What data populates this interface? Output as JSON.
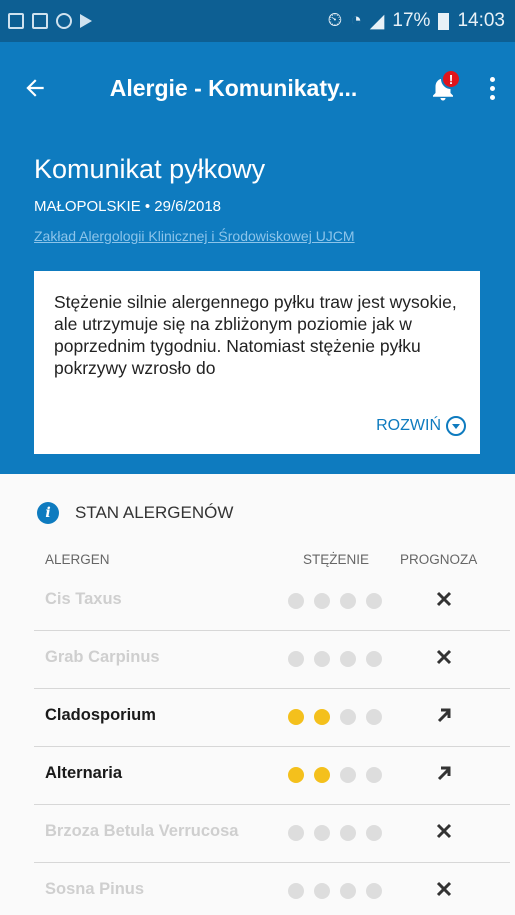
{
  "status_bar": {
    "icons": [
      "gallery-icon",
      "clipboard-icon",
      "bug-icon",
      "play-store-icon"
    ],
    "right_text": "⏲ ◴ ◢ 17% ",
    "battery_percent": "17%",
    "time": "14:03"
  },
  "appbar": {
    "title": "Alergie - Komunikaty...",
    "notification_badge": "!"
  },
  "header": {
    "title": "Komunikat pyłkowy",
    "meta": "MAŁOPOLSKIE • 29/6/2018",
    "link": "Zakład Alergologii Klinicznej i Środowiskowej UJCM",
    "card_text": "Stężenie silnie alergennego pyłku traw jest wysokie, ale utrzymuje się na zbliżonym poziomie jak w poprzednim tygodniu. Natomiast stężenie pyłku pokrzywy wzrosło do",
    "expand_label": "ROZWIŃ"
  },
  "allergens": {
    "section_title": "STAN ALERGENÓW",
    "col_allergen": "ALERGEN",
    "col_concentration": "STĘŻENIE",
    "col_forecast": "PROGNOZA",
    "rows": [
      {
        "name": "Cis Taxus",
        "active": false,
        "level": 0,
        "forecast": "none"
      },
      {
        "name": "Grab Carpinus",
        "active": false,
        "level": 0,
        "forecast": "none"
      },
      {
        "name": "Cladosporium",
        "active": true,
        "level": 2,
        "forecast": "rising"
      },
      {
        "name": "Alternaria",
        "active": true,
        "level": 2,
        "forecast": "rising"
      },
      {
        "name": "Brzoza Betula Verrucosa",
        "active": false,
        "level": 0,
        "forecast": "none"
      },
      {
        "name": "Sosna Pinus",
        "active": false,
        "level": 0,
        "forecast": "none"
      }
    ],
    "max_level": 4
  },
  "colors": {
    "primary": "#0e7bbf",
    "statusbar": "#0d5f93",
    "badge": "#e0141b",
    "dot_on": "#f4c01c",
    "dot_off": "#dddddd"
  }
}
